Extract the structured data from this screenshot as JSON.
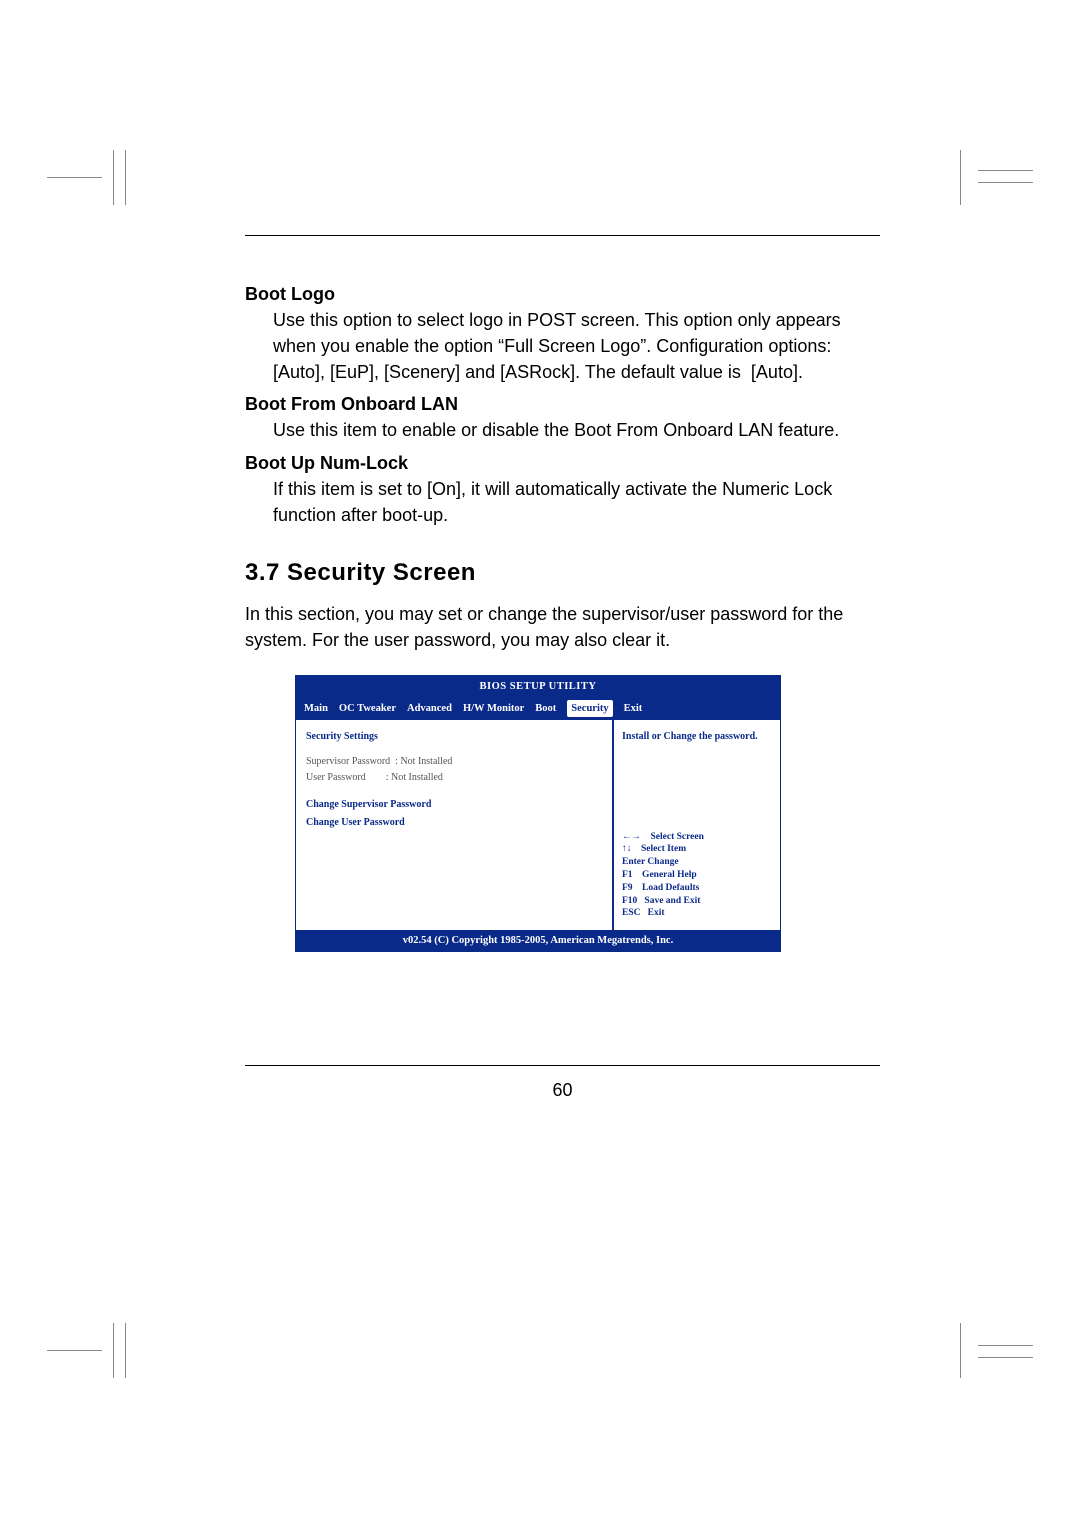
{
  "doc": {
    "boot_logo": {
      "title": "Boot Logo",
      "body": "Use this option to select logo in POST screen. This option only appears when you enable the option “Full Screen Logo”. Configuration options: [Auto], [EuP], [Scenery] and [ASRock]. The default value is  [Auto]."
    },
    "boot_lan": {
      "title": "Boot From Onboard LAN",
      "body": "Use this item to enable or disable the Boot From Onboard LAN feature."
    },
    "boot_numlock": {
      "title": "Boot Up Num-Lock",
      "body": "If this item is set to [On], it will automatically activate the Numeric Lock function after boot-up."
    },
    "section_heading": "3.7  Security Screen",
    "section_intro": "In this section, you may set or change the supervisor/user password for the system. For the user password, you may also clear it.",
    "page_number": "60"
  },
  "bios": {
    "title": "BIOS SETUP UTILITY",
    "tabs": [
      "Main",
      "OC Tweaker",
      "Advanced",
      "H/W Monitor",
      "Boot",
      "Security",
      "Exit"
    ],
    "active_tab_index": 5,
    "left": {
      "heading": "Security Settings",
      "rows": [
        "Supervisor Password  : Not Installed",
        "User Password        : Not Installed"
      ],
      "links": [
        "Change Supervisor Password",
        "Change User Password"
      ]
    },
    "right": {
      "help": "Install or Change the password.",
      "keys": [
        {
          "k": "←→",
          "d": "Select Screen"
        },
        {
          "k": "↑↓",
          "d": "Select Item"
        },
        {
          "k": "Enter",
          "d": "Change"
        },
        {
          "k": "F1",
          "d": "General Help"
        },
        {
          "k": "F9",
          "d": "Load Defaults"
        },
        {
          "k": "F10",
          "d": "Save and Exit"
        },
        {
          "k": "ESC",
          "d": "Exit"
        }
      ]
    },
    "footer": "v02.54 (C) Copyright 1985-2005, American Megatrends, Inc."
  }
}
